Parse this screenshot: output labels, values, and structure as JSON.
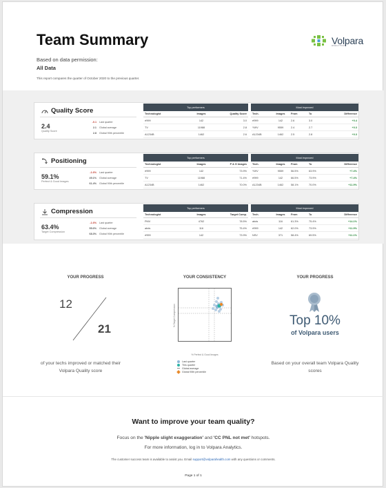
{
  "header": {
    "title": "Team Summary",
    "logo_text": "Volpara",
    "logo_sub": "ANALYTICS",
    "permission_label": "Based on data permission:",
    "permission_value": "All Data",
    "comparison_note": "This report compares the quarter of October 2020 to the previous quarter."
  },
  "quality": {
    "title": "Quality Score",
    "value": "2.4",
    "sub": "Quality Score",
    "stats": [
      {
        "val": "-0.1",
        "label": "Last quarter"
      },
      {
        "val": "2.1",
        "label": "Global average"
      },
      {
        "val": "2.8",
        "label": "Global 90th percentile"
      }
    ],
    "top": {
      "heading": "Top performers",
      "cols": [
        "Technologist",
        "Images",
        "Quality Score"
      ],
      "rows": [
        [
          "rf999",
          "142",
          "3.0"
        ],
        [
          "TV",
          "11988",
          "2.8"
        ],
        [
          "A1234B",
          "1462",
          "2.6"
        ]
      ]
    },
    "most": {
      "heading": "Most improved",
      "cols": [
        "Tech.",
        "Images",
        "From",
        "To",
        "Difference"
      ],
      "rows": [
        [
          "rf999",
          "142",
          "2.6",
          "3.0",
          "+0.4"
        ],
        [
          "YWV",
          "9559",
          "2.4",
          "2.7",
          "+0.3"
        ],
        [
          "A1234B",
          "1462",
          "2.5",
          "2.8",
          "+0.3"
        ]
      ]
    }
  },
  "positioning": {
    "title": "Positioning",
    "value": "59.1%",
    "sub": "Perfect & Good Images",
    "stats": [
      {
        "val": "-1.6%",
        "label": "Last quarter"
      },
      {
        "val": "49.1%",
        "label": "Global average"
      },
      {
        "val": "61.4%",
        "label": "Global 90th percentile"
      }
    ],
    "top": {
      "heading": "Top performers",
      "cols": [
        "Technologist",
        "Images",
        "P & G Images"
      ],
      "rows": [
        [
          "rf999",
          "142",
          "73.9%"
        ],
        [
          "TV",
          "11988",
          "71.4%"
        ],
        [
          "A1234B",
          "1462",
          "70.0%"
        ]
      ]
    },
    "most": {
      "heading": "Most improved",
      "cols": [
        "Tech.",
        "Images",
        "From",
        "To",
        "Difference"
      ],
      "rows": [
        [
          "YWV",
          "9559",
          "56.5%",
          "63.9%",
          "+7.4%"
        ],
        [
          "rf999",
          "142",
          "66.5%",
          "73.9%",
          "+7.4%"
        ],
        [
          "A1234B",
          "1462",
          "58.1%",
          "70.0%",
          "+11.9%"
        ]
      ]
    }
  },
  "compression": {
    "title": "Compression",
    "value": "63.4%",
    "sub": "Target Compression",
    "stats": [
      {
        "val": "-1.6%",
        "label": "Last quarter"
      },
      {
        "val": "55.6%",
        "label": "Global average"
      },
      {
        "val": "68.3%",
        "label": "Global 90th percentile"
      }
    ],
    "top": {
      "heading": "Top performers",
      "cols": [
        "Technologist",
        "Images",
        "Target Comp."
      ],
      "rows": [
        [
          "PMV",
          "4762",
          "78.5%"
        ],
        [
          "abds",
          "116",
          "75.4%"
        ],
        [
          "rf999",
          "142",
          "73.9%"
        ]
      ]
    },
    "most": {
      "heading": "Most improved",
      "cols": [
        "Tech.",
        "Images",
        "From",
        "To",
        "Difference"
      ],
      "rows": [
        [
          "abds",
          "116",
          "61.3%",
          "75.4%",
          "+14.1%"
        ],
        [
          "rf999",
          "142",
          "62.0%",
          "73.9%",
          "+11.9%"
        ],
        [
          "NSV",
          "371",
          "58.4%",
          "69.5%",
          "+11.1%"
        ]
      ]
    }
  },
  "progress": {
    "heading": "YOUR PROGRESS",
    "improved": "12",
    "total": "21",
    "text": "of your techs improved or matched their Volpara Quality score"
  },
  "consistency": {
    "heading": "YOUR CONSISTENCY",
    "y_label": "% Target Compression",
    "x_label": "% Perfect & Good Images",
    "legend": [
      {
        "label": "Last quarter",
        "color": "#8fb8d8"
      },
      {
        "label": "This quarter",
        "color": "#2bb3a6"
      },
      {
        "label": "Global average",
        "color": "#8a8a8a"
      },
      {
        "label": "Global 90th percentile",
        "color": "#e88a2b"
      }
    ]
  },
  "ranking": {
    "heading": "YOUR PROGRESS",
    "top": "Top 10%",
    "sub": "of Volpara users",
    "text": "Based on your overall team Volpara Quality scores"
  },
  "improve": {
    "title": "Want to improve your team quality?",
    "line1_pre": "Focus on the ",
    "hot1": "'Nipple slight exaggeration'",
    "line1_mid": " and ",
    "hot2": "'CC PNL not met'",
    "line1_post": " hotspots.",
    "line2": "For more information, log in to Volpara Analytics.",
    "line3_pre": "The customer success team is available to assist you. Email ",
    "email": "support@volparahealth.com",
    "line3_post": " with any questions or comments."
  },
  "footer": {
    "page": "Page 1 of 1"
  }
}
